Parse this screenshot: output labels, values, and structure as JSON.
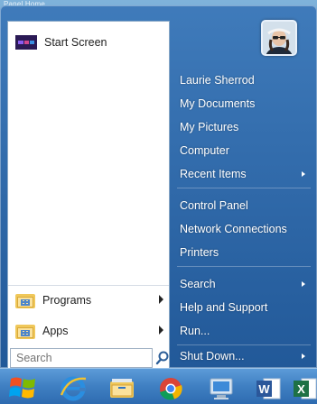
{
  "background_title": "Panel Home",
  "left_panel": {
    "start_screen_label": "Start Screen",
    "programs_label": "Programs",
    "apps_label": "Apps",
    "search_placeholder": "Search"
  },
  "user": {
    "name": "Laurie Sherrod"
  },
  "right_panel": {
    "items": [
      {
        "label": "Laurie Sherrod",
        "submenu": false
      },
      {
        "label": "My Documents",
        "submenu": false
      },
      {
        "label": "My Pictures",
        "submenu": false
      },
      {
        "label": "Computer",
        "submenu": false
      },
      {
        "label": "Recent Items",
        "submenu": true
      },
      {
        "label": "Control Panel",
        "submenu": false
      },
      {
        "label": "Network Connections",
        "submenu": false
      },
      {
        "label": "Printers",
        "submenu": false
      },
      {
        "label": "Search",
        "submenu": true
      },
      {
        "label": "Help and Support",
        "submenu": false
      },
      {
        "label": "Run...",
        "submenu": false
      },
      {
        "label": "Shut Down...",
        "submenu": true
      }
    ]
  },
  "taskbar": {
    "icons": [
      "windows-logo-icon",
      "internet-explorer-icon",
      "file-explorer-icon",
      "chrome-icon",
      "remote-desktop-icon",
      "word-icon",
      "excel-icon"
    ]
  },
  "colors": {
    "menu_blue": "#2f6aa3",
    "panel_white": "#ffffff",
    "taskbar_blue": "#3f7fc2"
  }
}
